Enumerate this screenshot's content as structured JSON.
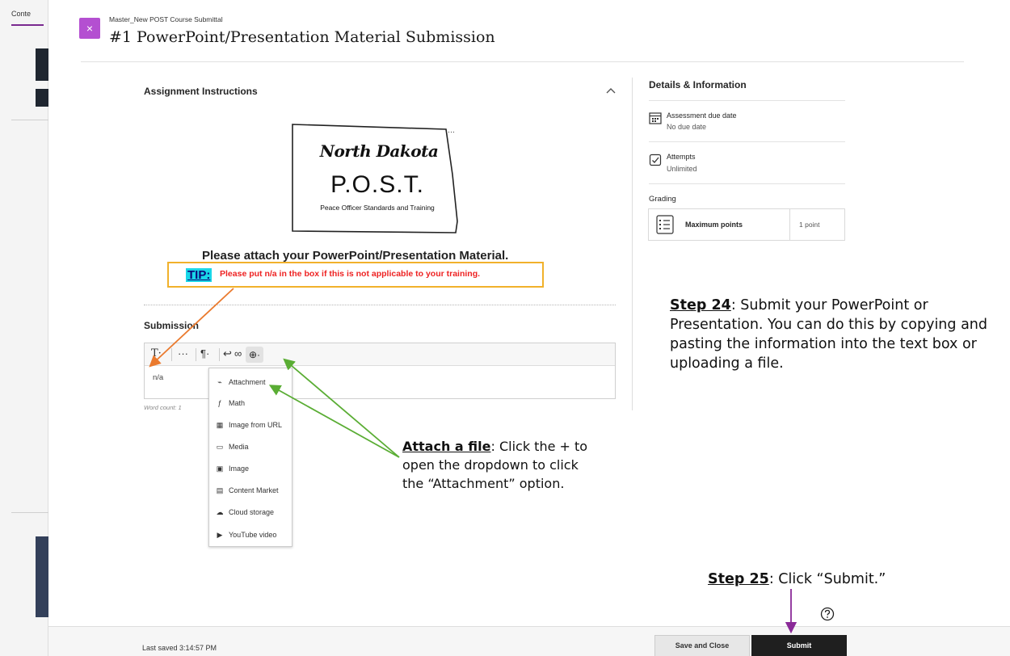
{
  "background": {
    "tab_label": "Conte"
  },
  "panel": {
    "breadcrumb": "Master_New POST Course Submittal",
    "title": "#1 PowerPoint/Presentation Material Submission",
    "close_glyph": "×"
  },
  "instructions": {
    "heading": "Assignment Instructions",
    "logo": {
      "state": "North Dakota",
      "acronym": "P.O.S.T.",
      "subtitle": "Peace Officer Standards and Training"
    },
    "attach_heading": "Please attach your PowerPoint/Presentation Material.",
    "tip_label": "TIP:",
    "tip_text": "Please put n/a in the box if this is not applicable to your training."
  },
  "submission": {
    "heading": "Submission",
    "toolbar": {
      "text_style": "T·",
      "more": "···",
      "paragraph": "¶·",
      "undo": "↩",
      "link": "∞",
      "insert": "⊕·"
    },
    "editor_text": "n/a",
    "word_count": "Word count: 1",
    "insert_menu": [
      {
        "label": "Attachment",
        "icon": "paperclip-icon",
        "glyph": "⌁"
      },
      {
        "label": "Math",
        "icon": "math-icon",
        "glyph": "ƒ"
      },
      {
        "label": "Image from URL",
        "icon": "image-url-icon",
        "glyph": "▦"
      },
      {
        "label": "Media",
        "icon": "media-icon",
        "glyph": "▭"
      },
      {
        "label": "Image",
        "icon": "image-icon",
        "glyph": "▣"
      },
      {
        "label": "Content Market",
        "icon": "cart-icon",
        "glyph": "▤"
      },
      {
        "label": "Cloud storage",
        "icon": "cloud-icon",
        "glyph": "☁"
      },
      {
        "label": "YouTube video",
        "icon": "youtube-icon",
        "glyph": "▶"
      }
    ]
  },
  "details": {
    "heading": "Details & Information",
    "due_label": "Assessment due date",
    "due_value": "No due date",
    "attempts_label": "Attempts",
    "attempts_value": "Unlimited",
    "grading_label": "Grading",
    "grade_name": "Maximum points",
    "grade_value": "1 point"
  },
  "annotations": {
    "attach_title": "Attach a file",
    "attach_body": ": Click the + to open the dropdown to click the “Attachment” option.",
    "step24_title": "Step 24",
    "step24_body": ": Submit your PowerPoint or Presentation. You can do this by copying and pasting the information into the text box or uploading a file.",
    "step25_title": "Step 25",
    "step25_body": ": Click “Submit.”"
  },
  "footer": {
    "last_saved": "Last saved 3:14:57 PM",
    "save_close": "Save and Close",
    "submit": "Submit"
  },
  "colors": {
    "close_button": "#b44fd1",
    "tip_border": "#f1b12b",
    "tip_highlight": "#19d6e8",
    "tip_text": "#ee2222",
    "orange_arrow": "#ea7a2e",
    "green_arrow": "#5aad34",
    "purple_arrow": "#8a2a98",
    "submit_button": "#1f1f1f"
  }
}
